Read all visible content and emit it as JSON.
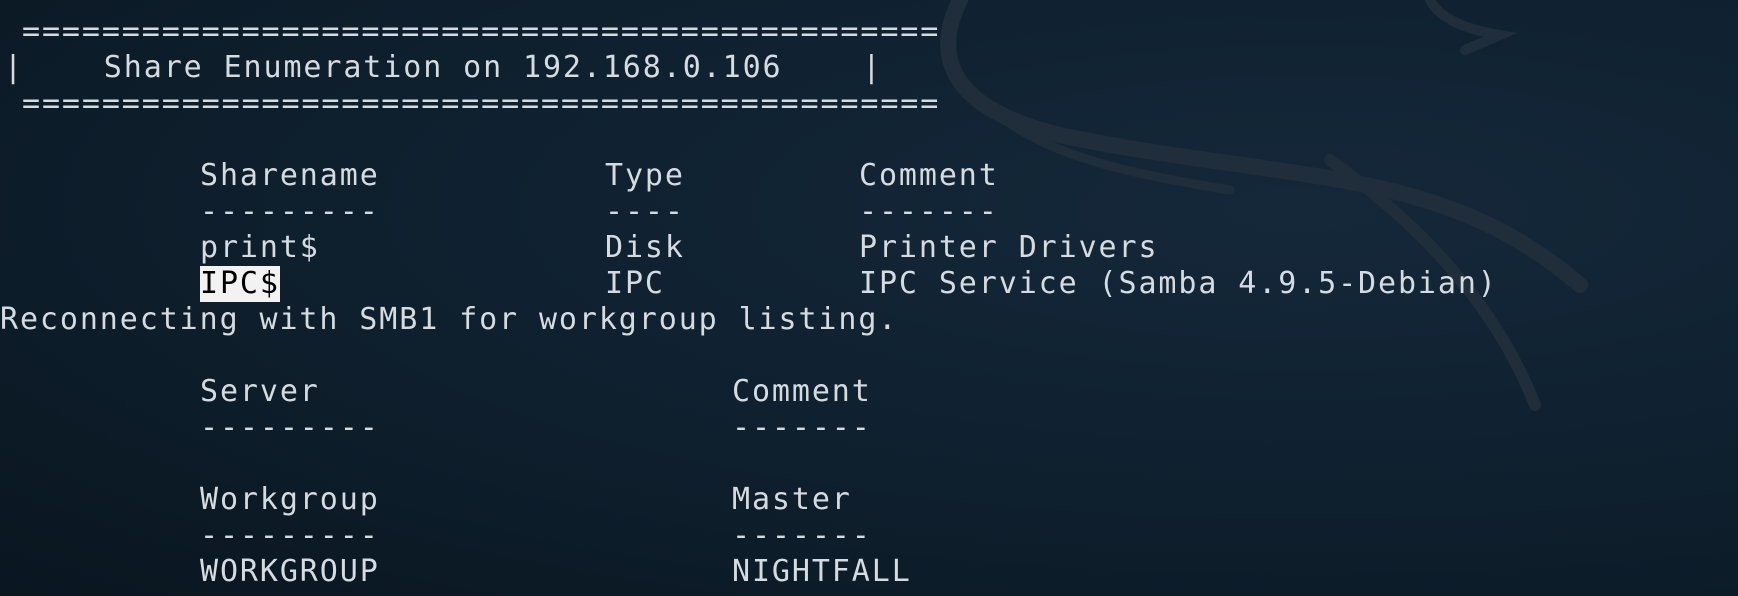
{
  "theme": {
    "background": "#0f2130",
    "text_color": "#d6dbe0",
    "highlight_bg": "#f2f2f2",
    "highlight_fg": "#000000"
  },
  "banner": {
    "rule_top": "==============================================",
    "title_line": "|    Share Enumeration on 192.168.0.106    |",
    "rule_bottom": "=============================================="
  },
  "shares": {
    "headers": [
      "Sharename",
      "Type",
      "Comment"
    ],
    "dashes": [
      "---------",
      "----",
      "-------"
    ],
    "rows": [
      [
        "print$",
        "Disk",
        "Printer Drivers"
      ],
      [
        "IPC$",
        "IPC",
        "IPC Service (Samba 4.9.5-Debian)"
      ]
    ]
  },
  "reconnect_message": "Reconnecting with SMB1 for workgroup listing.",
  "servers": {
    "headers": [
      "Server",
      "Comment"
    ],
    "dashes": [
      "---------",
      "-------"
    ]
  },
  "workgroups": {
    "headers": [
      "Workgroup",
      "Master"
    ],
    "dashes": [
      "---------",
      "-------"
    ],
    "rows": [
      [
        "WORKGROUP",
        "NIGHTFALL"
      ]
    ]
  },
  "background_art": "kali-dragon-logo"
}
